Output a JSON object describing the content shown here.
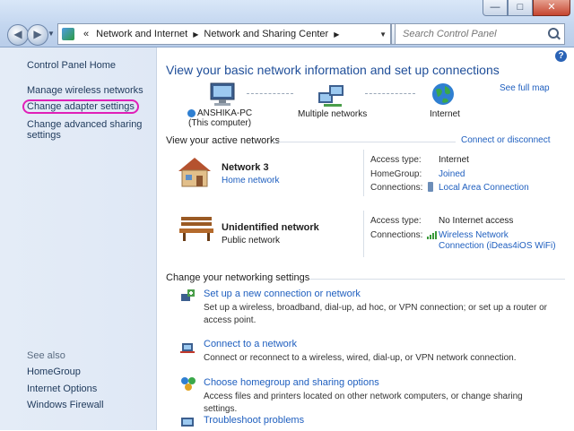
{
  "window": {
    "controls": {
      "minimize": "—",
      "maximize": "□",
      "close": "✕"
    }
  },
  "address_bar": {
    "prefix": "«",
    "segments": [
      "Network and Internet",
      "Network and Sharing Center"
    ]
  },
  "search": {
    "placeholder": "Search Control Panel"
  },
  "sidebar": {
    "items": [
      {
        "label": "Control Panel Home"
      },
      {
        "label": "Manage wireless networks"
      },
      {
        "label": "Change adapter settings"
      },
      {
        "label": "Change advanced sharing"
      },
      {
        "label": "settings"
      }
    ],
    "see_also_heading": "See also",
    "see_also": [
      "HomeGroup",
      "Internet Options",
      "Windows Firewall"
    ]
  },
  "main": {
    "title": "View your basic network information and set up connections",
    "see_full_map": "See full map",
    "map": {
      "computer_name": "ANSHIKA-PC",
      "computer_sub": "(This computer)",
      "middle": "Multiple networks",
      "internet": "Internet"
    },
    "active_heading": "View your active networks",
    "connect_or_disconnect": "Connect or disconnect",
    "networks": [
      {
        "name": "Network  3",
        "type": "Home network",
        "access_type_label": "Access type:",
        "access_type": "Internet",
        "homegroup_label": "HomeGroup:",
        "homegroup": "Joined",
        "connections_label": "Connections:",
        "connection": "Local Area Connection"
      },
      {
        "name": "Unidentified network",
        "type": "Public network",
        "access_type_label": "Access type:",
        "access_type": "No Internet access",
        "connections_label": "Connections:",
        "connection_line1": "Wireless Network",
        "connection_line2": "Connection (iDeas4iOS WiFi)"
      }
    ],
    "change_heading": "Change your networking settings",
    "tasks": [
      {
        "title": "Set up a new connection or network",
        "desc": "Set up a wireless, broadband, dial-up, ad hoc, or VPN connection; or set up a router or access point."
      },
      {
        "title": "Connect to a network",
        "desc": "Connect or reconnect to a wireless, wired, dial-up, or VPN network connection."
      },
      {
        "title": "Choose homegroup and sharing options",
        "desc": "Access files and printers located on other network computers, or change sharing settings."
      },
      {
        "title": "Troubleshoot problems",
        "desc": ""
      }
    ]
  }
}
